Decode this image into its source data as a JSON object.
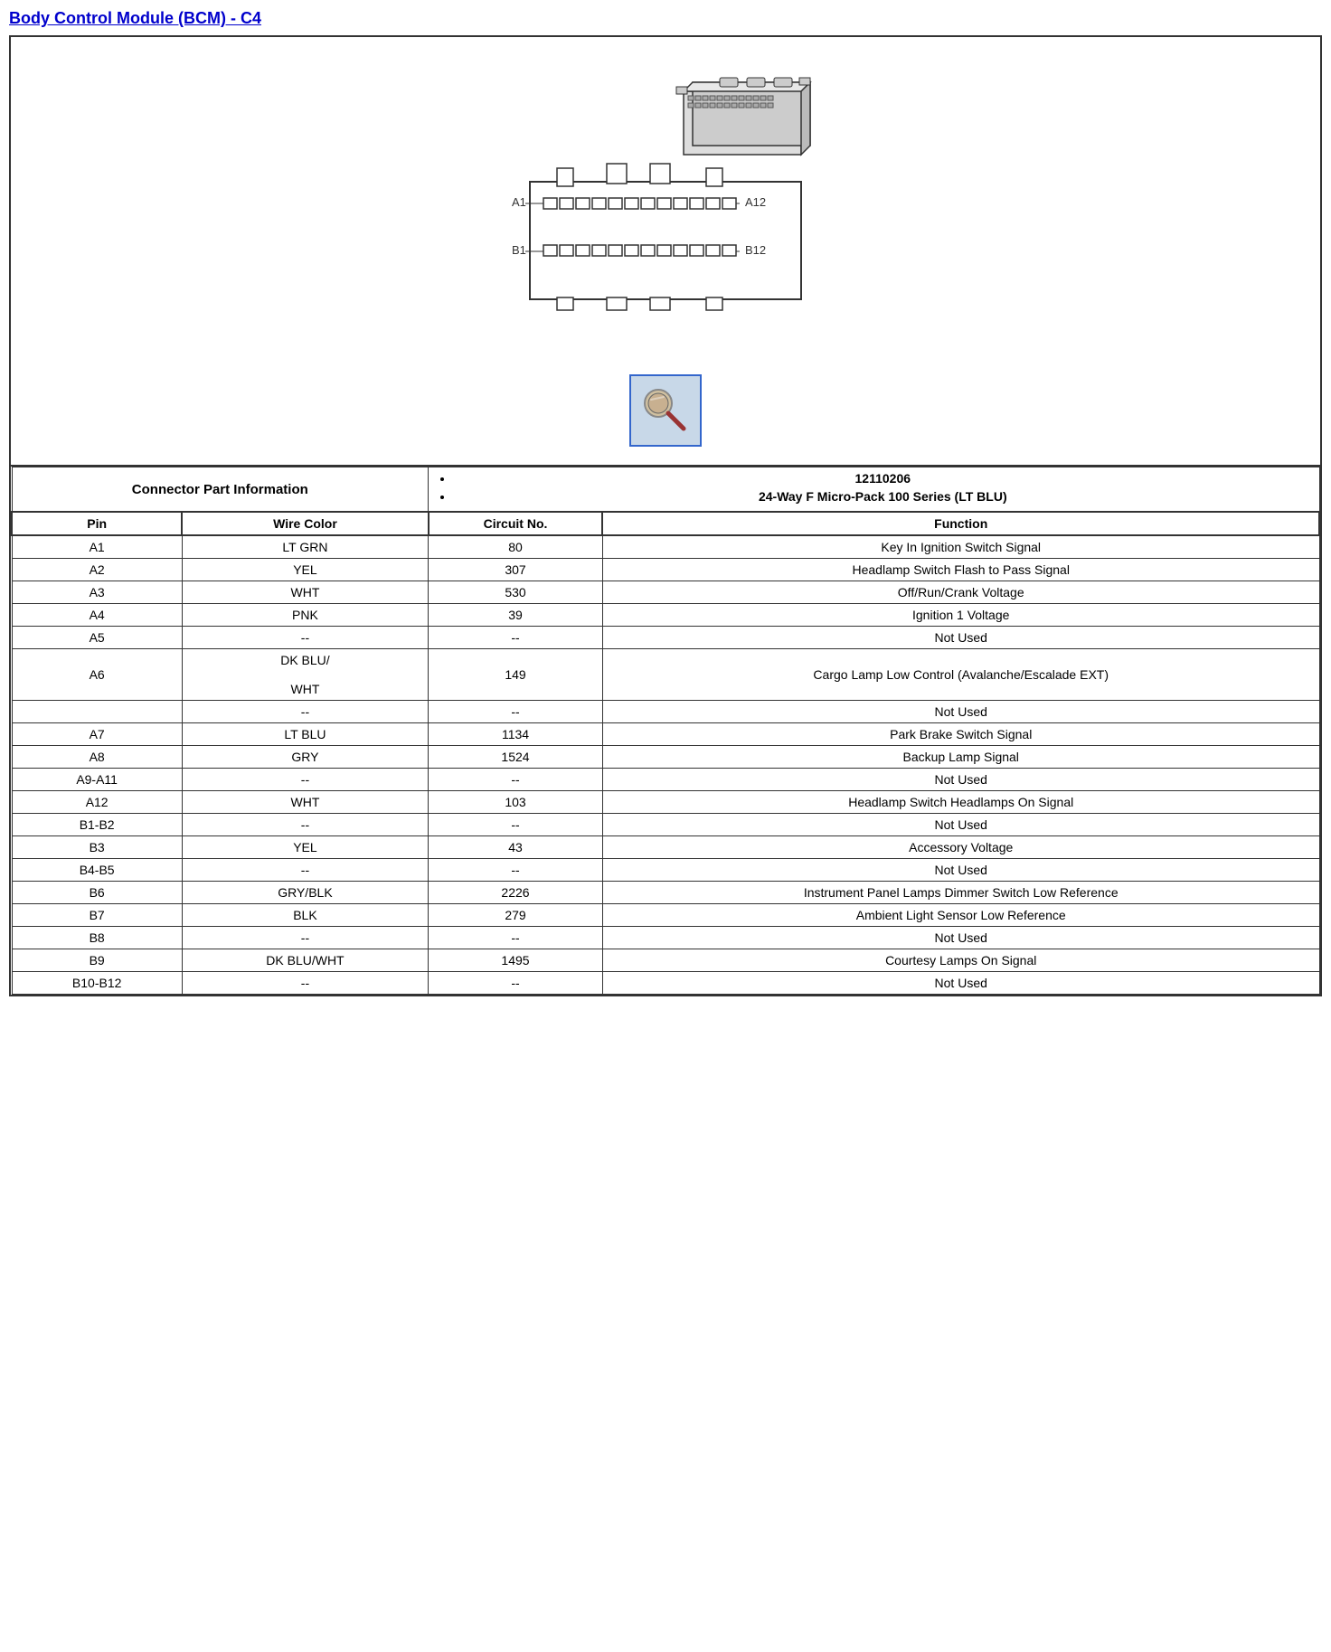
{
  "title": "Body Control Module (BCM) - C4",
  "connector_part_label": "Connector Part Information",
  "connector_part_details": [
    "12110206",
    "24-Way F Micro-Pack 100 Series (LT BLU)"
  ],
  "table_headers": [
    "Pin",
    "Wire Color",
    "Circuit No.",
    "Function"
  ],
  "rows": [
    {
      "pin": "A1",
      "wire_color": "LT GRN",
      "circuit": "80",
      "function": "Key In Ignition Switch Signal"
    },
    {
      "pin": "A2",
      "wire_color": "YEL",
      "circuit": "307",
      "function": "Headlamp Switch Flash to Pass Signal"
    },
    {
      "pin": "A3",
      "wire_color": "WHT",
      "circuit": "530",
      "function": "Off/Run/Crank Voltage"
    },
    {
      "pin": "A4",
      "wire_color": "PNK",
      "circuit": "39",
      "function": "Ignition 1 Voltage"
    },
    {
      "pin": "A5",
      "wire_color": "--",
      "circuit": "--",
      "function": "Not Used"
    },
    {
      "pin": "A6",
      "wire_color": "DK BLU/\n\nWHT",
      "circuit": "149",
      "function": "Cargo Lamp Low Control (Avalanche/Escalade EXT)"
    },
    {
      "pin": "",
      "wire_color": "--",
      "circuit": "--",
      "function": "Not Used"
    },
    {
      "pin": "A7",
      "wire_color": "LT BLU",
      "circuit": "1134",
      "function": "Park Brake Switch Signal"
    },
    {
      "pin": "A8",
      "wire_color": "GRY",
      "circuit": "1524",
      "function": "Backup Lamp Signal"
    },
    {
      "pin": "A9-A11",
      "wire_color": "--",
      "circuit": "--",
      "function": "Not Used"
    },
    {
      "pin": "A12",
      "wire_color": "WHT",
      "circuit": "103",
      "function": "Headlamp Switch Headlamps On Signal"
    },
    {
      "pin": "B1-B2",
      "wire_color": "--",
      "circuit": "--",
      "function": "Not Used"
    },
    {
      "pin": "B3",
      "wire_color": "YEL",
      "circuit": "43",
      "function": "Accessory Voltage"
    },
    {
      "pin": "B4-B5",
      "wire_color": "--",
      "circuit": "--",
      "function": "Not Used"
    },
    {
      "pin": "B6",
      "wire_color": "GRY/BLK",
      "circuit": "2226",
      "function": "Instrument Panel Lamps Dimmer Switch Low Reference"
    },
    {
      "pin": "B7",
      "wire_color": "BLK",
      "circuit": "279",
      "function": "Ambient Light Sensor Low Reference"
    },
    {
      "pin": "B8",
      "wire_color": "--",
      "circuit": "--",
      "function": "Not Used"
    },
    {
      "pin": "B9",
      "wire_color": "DK BLU/WHT",
      "circuit": "1495",
      "function": "Courtesy Lamps On Signal"
    },
    {
      "pin": "B10-B12",
      "wire_color": "--",
      "circuit": "--",
      "function": "Not Used"
    }
  ]
}
